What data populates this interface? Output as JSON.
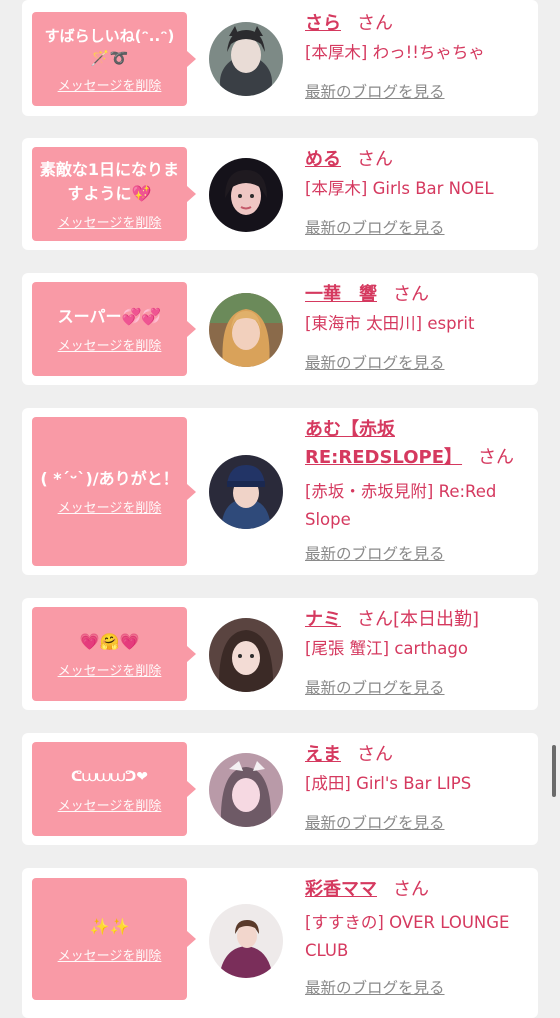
{
  "entries": [
    {
      "message": "すばらしいね(ᵔ..ᵔ)\n🪄➰",
      "delete_label": "メッセージを削除",
      "name": "さら",
      "honorific": "さん",
      "shop": "[本厚木] わっ!!ちゃちゃ",
      "blog_label": "最新のブログを見る",
      "avatar_icon": "avatar-photo"
    },
    {
      "message": "素敵な1日になりますように💖",
      "delete_label": "メッセージを削除",
      "name": "める",
      "honorific": "さん",
      "shop": "[本厚木] Girls Bar NOEL",
      "blog_label": "最新のブログを見る",
      "avatar_icon": "avatar-photo"
    },
    {
      "message": "スーパー💞💞",
      "delete_label": "メッセージを削除",
      "name": "一華　響",
      "honorific": "さん",
      "shop": "[東海市 太田川] esprit",
      "blog_label": "最新のブログを見る",
      "avatar_icon": "avatar-photo"
    },
    {
      "message": "( *ˊᵕˋ)/ありがと！",
      "delete_label": "メッセージを削除",
      "name": "あむ【赤坂RE:REDSLOPE】",
      "honorific": "さん",
      "shop": "[赤坂・赤坂見附] Re:Red Slope",
      "blog_label": "最新のブログを見る",
      "avatar_icon": "avatar-photo"
    },
    {
      "message": "💗🤗💗",
      "delete_label": "メッセージを削除",
      "name": "ナミ",
      "honorific": "さん[本日出勤]",
      "shop": "[尾張 蟹江] carthago",
      "blog_label": "最新のブログを見る",
      "avatar_icon": "avatar-photo"
    },
    {
      "message": "ᕦ⩊⩊⩊ᕤ❤",
      "delete_label": "メッセージを削除",
      "name": "えま",
      "honorific": "さん",
      "shop": "[成田] Girl's Bar LIPS",
      "blog_label": "最新のブログを見る",
      "avatar_icon": "avatar-photo"
    },
    {
      "message": "✨✨",
      "delete_label": "メッセージを削除",
      "name": "彩香ママ",
      "honorific": "さん",
      "shop": "[すすきの] OVER LOUNGE CLUB",
      "blog_label": "最新のブログを見る",
      "avatar_icon": "avatar-photo"
    }
  ],
  "colors": {
    "accent": "#d5395f",
    "bubble": "#f99aa6",
    "background": "#efefef",
    "card": "#ffffff",
    "muted": "#8a8a8a"
  }
}
